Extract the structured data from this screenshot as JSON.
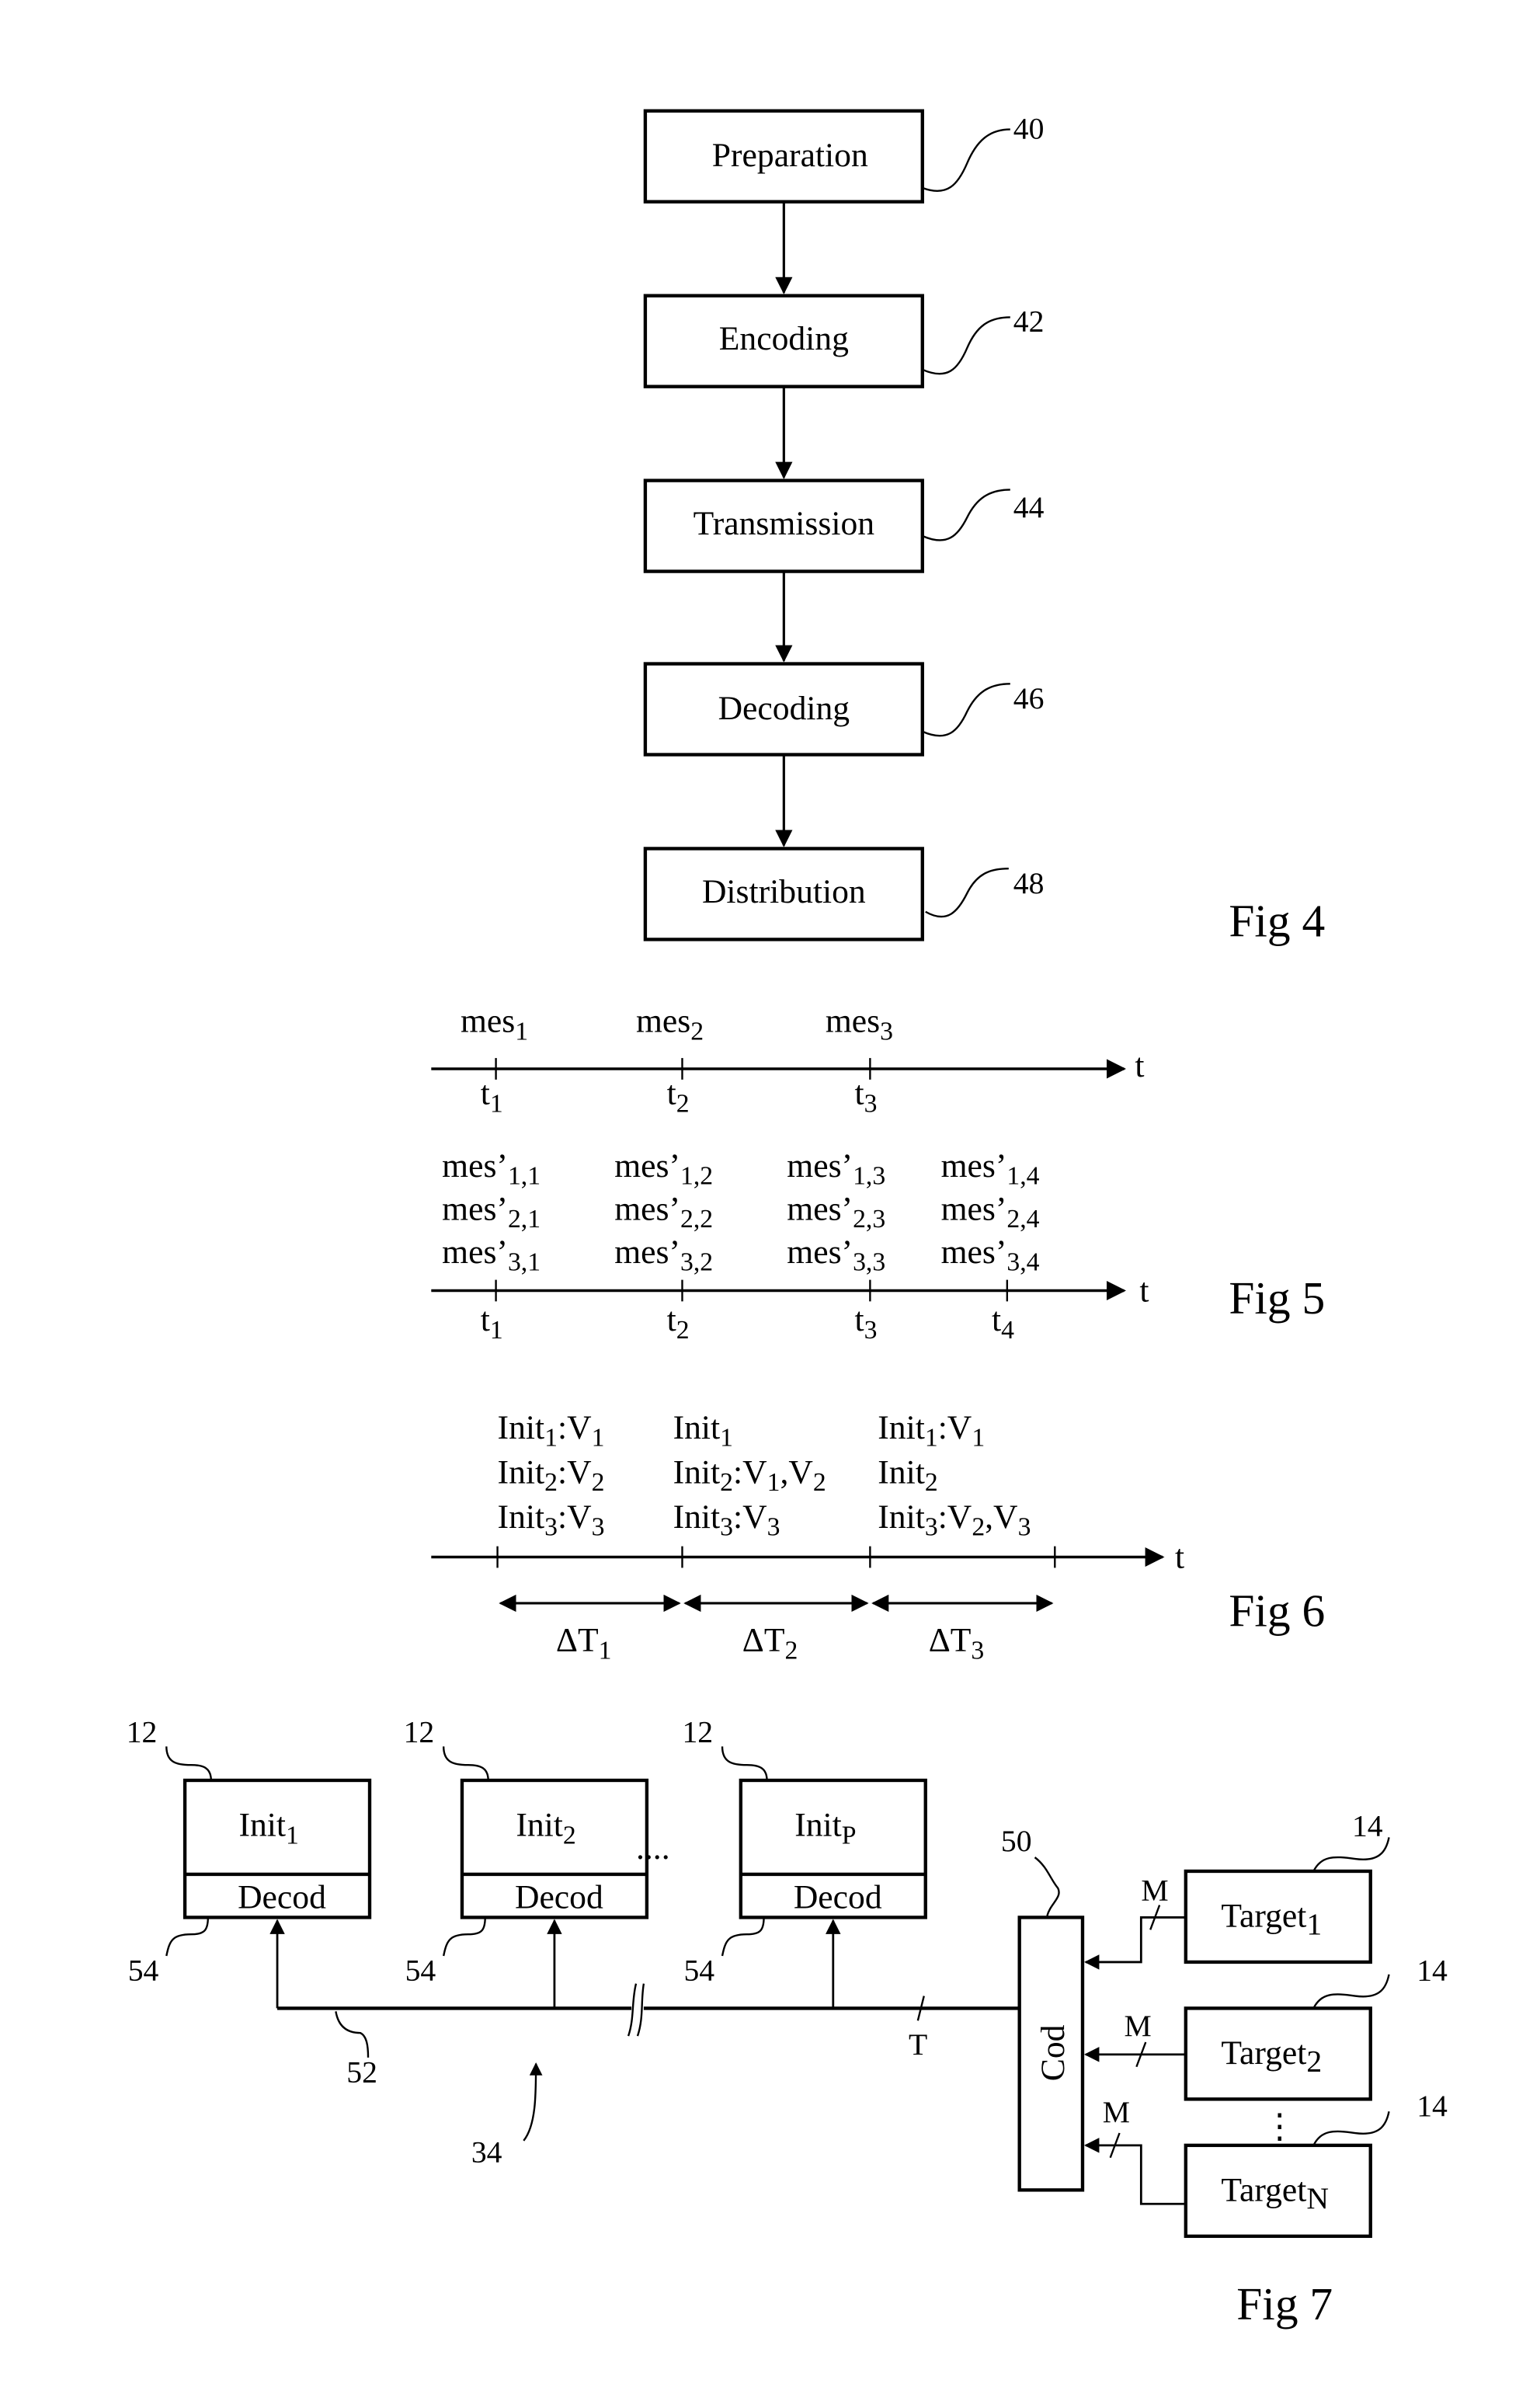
{
  "fig4": {
    "caption": "Fig 4",
    "steps": [
      {
        "label": "Preparation",
        "ref": "40"
      },
      {
        "label": "Encoding",
        "ref": "42"
      },
      {
        "label": "Transmission",
        "ref": "44"
      },
      {
        "label": "Decoding",
        "ref": "46"
      },
      {
        "label": "Distribution",
        "ref": "48"
      }
    ]
  },
  "fig5": {
    "caption": "Fig 5",
    "axis_label": "t",
    "top_timeline": {
      "messages": [
        {
          "base": "mes",
          "sub": "1"
        },
        {
          "base": "mes",
          "sub": "2"
        },
        {
          "base": "mes",
          "sub": "3"
        }
      ],
      "ticks": [
        {
          "base": "t",
          "sub": "1"
        },
        {
          "base": "t",
          "sub": "2"
        },
        {
          "base": "t",
          "sub": "3"
        }
      ]
    },
    "bottom_timeline": {
      "columns": [
        [
          {
            "base": "mes’",
            "sub": "1,1"
          },
          {
            "base": "mes’",
            "sub": "2,1"
          },
          {
            "base": "mes’",
            "sub": "3,1"
          }
        ],
        [
          {
            "base": "mes’",
            "sub": "1,2"
          },
          {
            "base": "mes’",
            "sub": "2,2"
          },
          {
            "base": "mes’",
            "sub": "3,2"
          }
        ],
        [
          {
            "base": "mes’",
            "sub": "1,3"
          },
          {
            "base": "mes’",
            "sub": "2,3"
          },
          {
            "base": "mes’",
            "sub": "3,3"
          }
        ],
        [
          {
            "base": "mes’",
            "sub": "1,4"
          },
          {
            "base": "mes’",
            "sub": "2,4"
          },
          {
            "base": "mes’",
            "sub": "3,4"
          }
        ]
      ],
      "ticks": [
        {
          "base": "t",
          "sub": "1"
        },
        {
          "base": "t",
          "sub": "2"
        },
        {
          "base": "t",
          "sub": "3"
        },
        {
          "base": "t",
          "sub": "4"
        }
      ]
    }
  },
  "fig6": {
    "caption": "Fig 6",
    "axis_label": "t",
    "columns": [
      [
        "Init1:V1",
        "Init2:V2",
        "Init3:V3"
      ],
      [
        "Init1",
        "Init2:V1,V2",
        "Init3:V3"
      ],
      [
        "Init1:V1",
        "Init2",
        "Init3:V2,V3"
      ]
    ],
    "intervals": [
      {
        "base": "ΔT",
        "sub": "1"
      },
      {
        "base": "ΔT",
        "sub": "2"
      },
      {
        "base": "ΔT",
        "sub": "3"
      }
    ]
  },
  "fig7": {
    "caption": "Fig 7",
    "initiators": [
      {
        "name": "Init",
        "sub": "1",
        "decoder": "Decod",
        "ref": "12",
        "decoder_ref": "54"
      },
      {
        "name": "Init",
        "sub": "2",
        "decoder": "Decod",
        "ref": "12",
        "decoder_ref": "54"
      },
      {
        "name": "Init",
        "sub": "P",
        "decoder": "Decod",
        "ref": "12",
        "decoder_ref": "54"
      }
    ],
    "ellipsis": "....",
    "coder": {
      "label": "Cod",
      "ref": "50"
    },
    "targets": [
      {
        "name": "Target",
        "sub": "1",
        "ref": "14",
        "link_label": "M"
      },
      {
        "name": "Target",
        "sub": "2",
        "ref": "14",
        "link_label": "M"
      },
      {
        "name": "Target",
        "sub": "N",
        "ref": "14",
        "link_label": "M"
      }
    ],
    "bus_ref": "52",
    "network_ref": "34",
    "bus_label": "T"
  }
}
